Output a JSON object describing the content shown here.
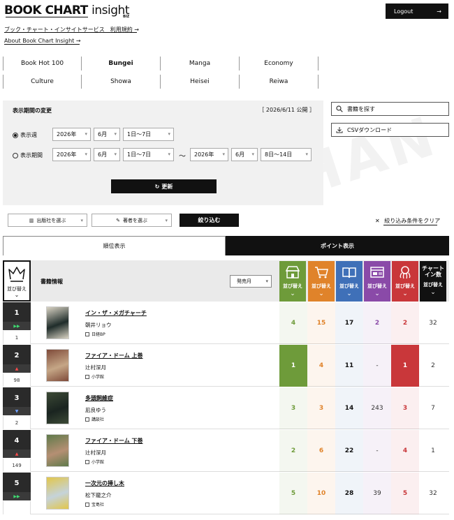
{
  "header": {
    "logo_main": "BOOK CHART",
    "logo_sub": "insight",
    "logo_biz": "BIZ",
    "logout_label": "Logout",
    "link_service": "ブック・チャート・インサイトサービス　利用規約 →",
    "link_about": "About Book Chart Insight →"
  },
  "categories": [
    {
      "label": "Book Hot 100",
      "active": false
    },
    {
      "label": "Bungei",
      "active": true
    },
    {
      "label": "Manga",
      "active": false
    },
    {
      "label": "Economy",
      "active": false
    },
    {
      "label": "Culture",
      "active": false
    },
    {
      "label": "Showa",
      "active": false
    },
    {
      "label": "Heisei",
      "active": false
    },
    {
      "label": "Reiwa",
      "active": false
    }
  ],
  "period_panel": {
    "title": "表示期間の変更",
    "published": "［ 2026/6/11 公開 ］",
    "radio_week": "表示週",
    "radio_range": "表示期間",
    "week": {
      "year": "2026年",
      "month": "6月",
      "day": "1日〜7日"
    },
    "range_from": {
      "year": "2026年",
      "month": "6月",
      "day": "1日〜7日"
    },
    "range_to": {
      "year": "2026年",
      "month": "6月",
      "day": "8日〜14日"
    },
    "tilde": "〜",
    "update_label": "更新"
  },
  "right_tools": {
    "search_label": "書籍を探す",
    "csv_label": "CSVダウンロード"
  },
  "watermark": "HAN",
  "filters": {
    "publisher_label": "出版社を選ぶ",
    "author_label": "著者を選ぶ",
    "narrow_label": "絞り込む",
    "clear_label": "絞り込み条件をクリア"
  },
  "view_tabs": [
    {
      "label": "順位表示",
      "active": false
    },
    {
      "label": "ポイント表示",
      "active": true
    }
  ],
  "table_header": {
    "sort_label": "並び替え",
    "chevron": "⌄",
    "book_info": "書籍情報",
    "sort_select": "発売月",
    "chart_in_line1": "チャート",
    "chart_in_line2": "イン数",
    "columns": [
      {
        "icon": "store-icon",
        "color": "#6e9b3a"
      },
      {
        "icon": "cart-icon",
        "color": "#e0832a"
      },
      {
        "icon": "book-icon",
        "color": "#3f70b8"
      },
      {
        "icon": "web-icon",
        "color": "#8a4aa8"
      },
      {
        "icon": "octopus-icon",
        "color": "#c9373a"
      },
      {
        "icon": "",
        "color": "#111111"
      }
    ]
  },
  "rows": [
    {
      "rank": "1",
      "movement": "same",
      "prev": "1",
      "title": "イン・ザ・メガチャーチ",
      "author": "朝井リョウ",
      "publisher": "日経BP",
      "v": [
        "4",
        "15",
        "17",
        "2",
        "2",
        "32"
      ],
      "cover_colors": [
        "#1f2c2a",
        "#d9d3c4"
      ]
    },
    {
      "rank": "2",
      "movement": "up",
      "prev": "98",
      "title": "ファイア・ドーム 上巻",
      "author": "辻村深月",
      "publisher": "小学館",
      "v": [
        "1",
        "4",
        "11",
        "-",
        "1",
        "2"
      ],
      "cover_colors": [
        "#c5a686",
        "#7f4b3a"
      ]
    },
    {
      "rank": "3",
      "movement": "down",
      "prev": "2",
      "title": "多頭飼維症",
      "author": "凪良ゆう",
      "publisher": "講談社",
      "v": [
        "3",
        "3",
        "14",
        "243",
        "3",
        "7"
      ],
      "cover_colors": [
        "#1a2420",
        "#3c4a36"
      ]
    },
    {
      "rank": "4",
      "movement": "up",
      "prev": "149",
      "title": "ファイア・ドーム 下巻",
      "author": "辻村深月",
      "publisher": "小学館",
      "v": [
        "2",
        "6",
        "22",
        "-",
        "4",
        "1"
      ],
      "cover_colors": [
        "#b58f73",
        "#5f7a4a"
      ]
    },
    {
      "rank": "5",
      "movement": "same",
      "prev": "",
      "title": "一次元の挿し木",
      "author": "松下龍之介",
      "publisher": "宝島社",
      "v": [
        "5",
        "10",
        "28",
        "39",
        "5",
        "32"
      ],
      "cover_colors": [
        "#c5d3da",
        "#e2c64a"
      ]
    }
  ]
}
